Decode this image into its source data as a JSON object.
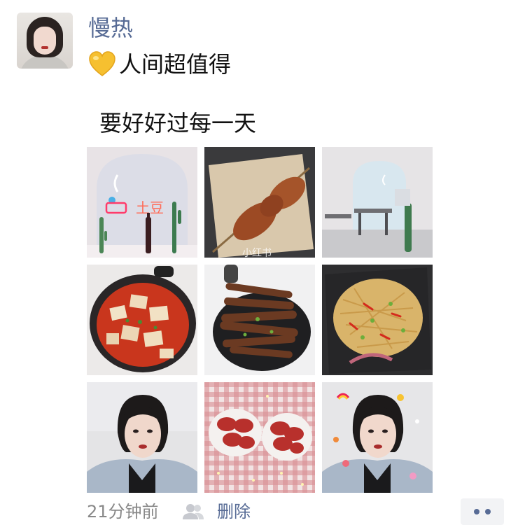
{
  "post": {
    "nickname": "慢热",
    "line1_text": "人间超值得",
    "line1_emoji": "yellow-heart-icon",
    "line2_text": "要好好过每一天",
    "timestamp": "21分钟前",
    "visibility_icon": "friends-icon",
    "delete_label": "删除",
    "more_icon": "more-dots-icon"
  },
  "photos": [
    {
      "subject": "restaurant neon sign",
      "sign_text": "土豆"
    },
    {
      "subject": "grilled skewer on paper",
      "watermark": "小红书"
    },
    {
      "subject": "restaurant interior"
    },
    {
      "subject": "tofu in red sauce pan"
    },
    {
      "subject": "braised chicken feet"
    },
    {
      "subject": "stir-fried potato strips"
    },
    {
      "subject": "selfie portrait"
    },
    {
      "subject": "cured meat on plates"
    },
    {
      "subject": "selfie portrait with stickers"
    }
  ],
  "colors": {
    "link": "#576b95",
    "text": "#111111",
    "meta": "#888888",
    "more_bg": "#f2f3f5"
  }
}
